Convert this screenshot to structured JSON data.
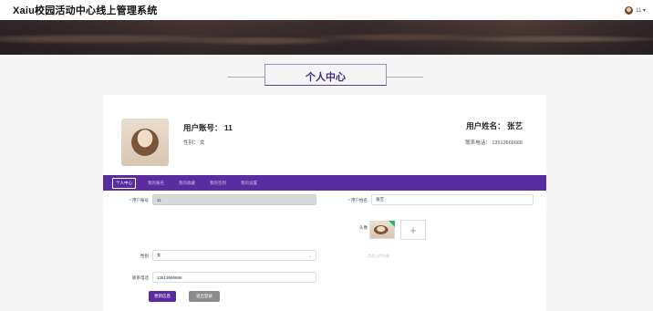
{
  "app": {
    "title": "Xaiu校园活动中心线上管理系统"
  },
  "user_menu": {
    "username": "11 ▾"
  },
  "section": {
    "title": "个人中心"
  },
  "profile": {
    "account_label": "用户账号：",
    "account_value": "11",
    "gender_label": "性别：",
    "gender_value": "女",
    "name_label": "用户姓名：",
    "name_value": "张艺",
    "phone_label": "联系电话：",
    "phone_value": "13513666666"
  },
  "tabs": [
    {
      "label": "个人中心",
      "active": true
    },
    {
      "label": "我的报名"
    },
    {
      "label": "我的收藏"
    },
    {
      "label": "我的签到"
    },
    {
      "label": "我的设置"
    }
  ],
  "form": {
    "account_label": "* 用户账号",
    "account_value": "11",
    "name_label": "* 用户姓名",
    "name_value": "张艺",
    "avatar_label": "头像",
    "upload_hint": "点击上传头像",
    "gender_label": "性别",
    "gender_value": "女",
    "phone_label": "联系电话",
    "phone_value": "13513666666",
    "submit_label": "更新信息",
    "logout_label": "退出登录"
  },
  "colors": {
    "accent": "#5b2ca0",
    "background": "#f5f5f5"
  }
}
